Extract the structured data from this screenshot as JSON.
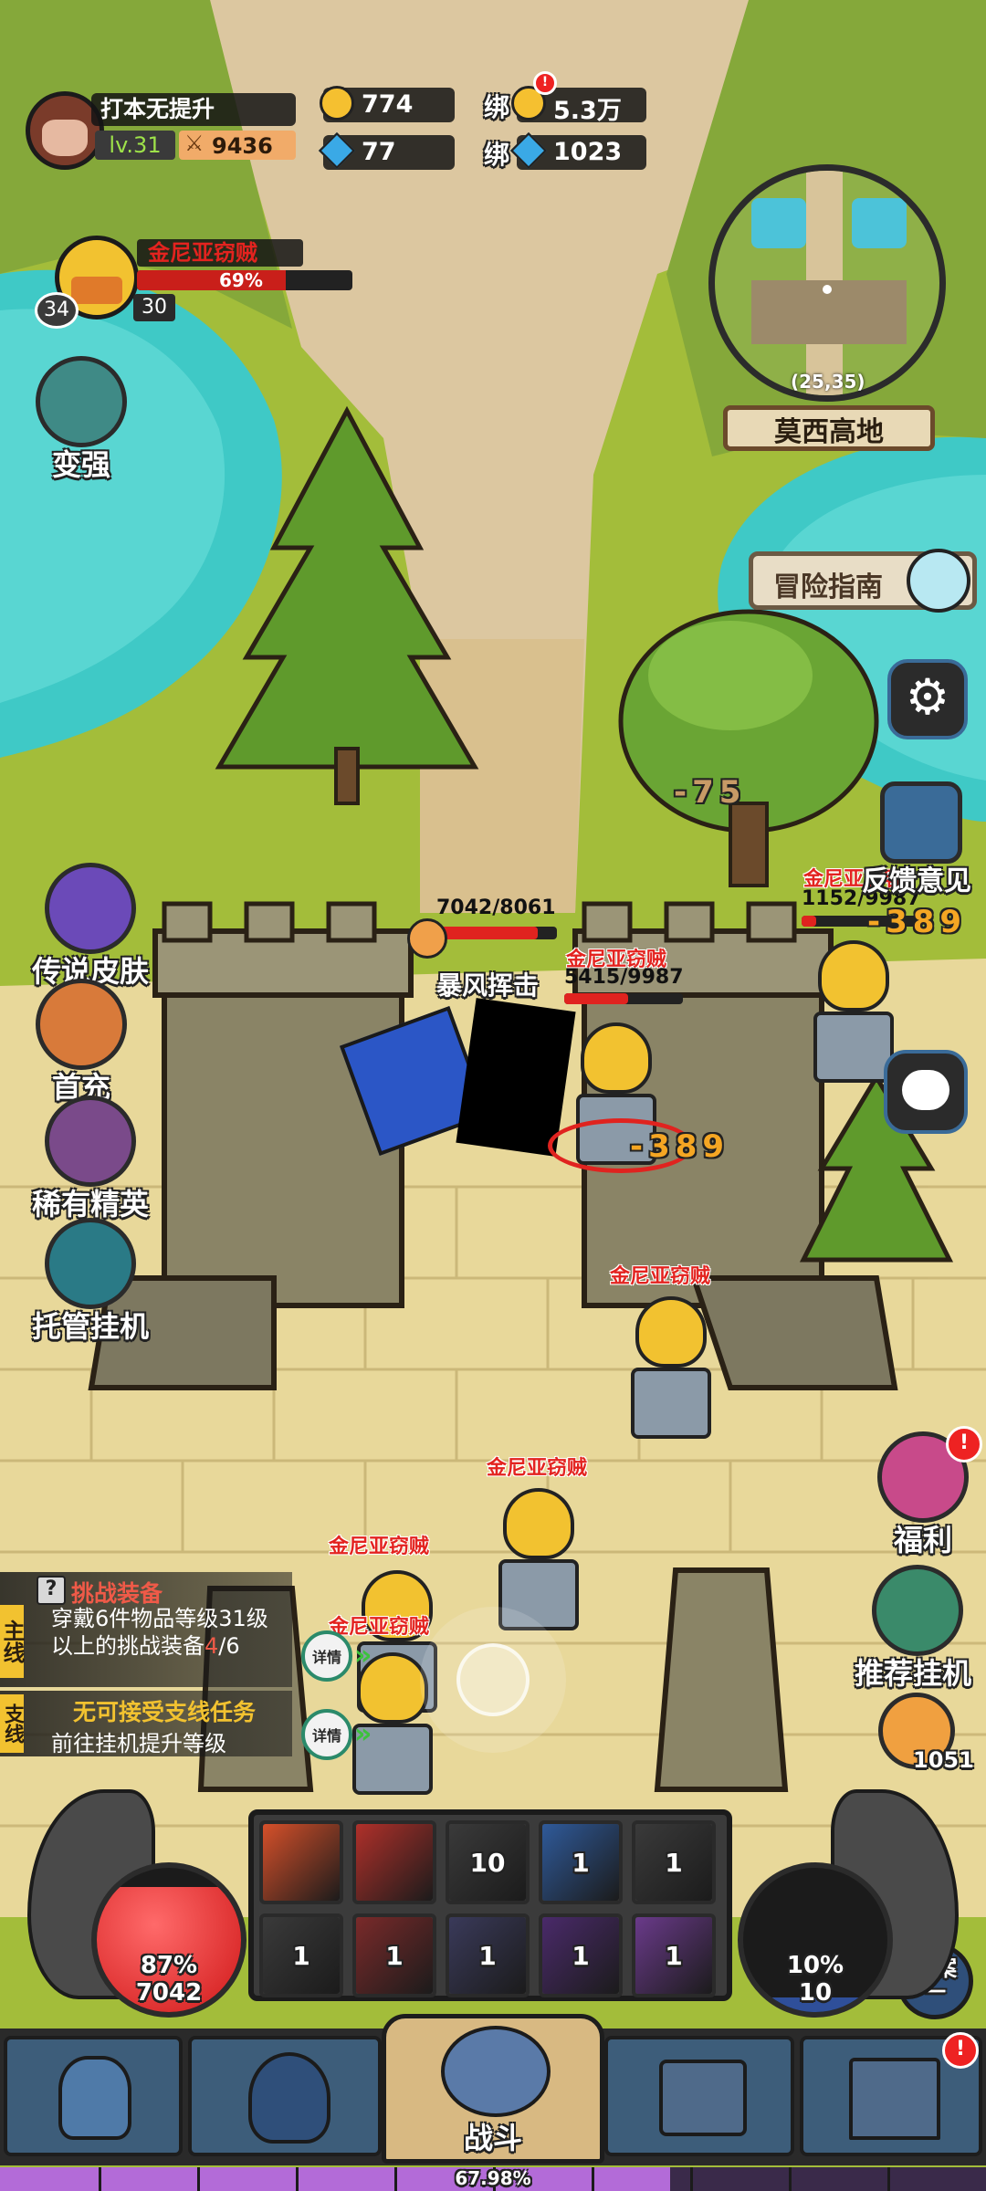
{
  "player": {
    "name": "打本无提升",
    "level": "lv.31",
    "power": "9436"
  },
  "currency": {
    "gold": "774",
    "diamond": "77",
    "bound_label_1": "绑",
    "bound_gold": "5.3万",
    "bound_label_2": "绑",
    "bound_diamond": "1023"
  },
  "target": {
    "name": "金尼亚窃贼",
    "hp_percent": 69,
    "hp_text": "69%",
    "level": "34",
    "count": "30"
  },
  "minimap": {
    "coords": "(25,35)",
    "location": "莫西高地"
  },
  "left_menu": [
    {
      "label": "变强",
      "icon": "upgrade-icon"
    },
    {
      "label": "传说皮肤",
      "icon": "legend-skin-icon"
    },
    {
      "label": "首充",
      "icon": "first-charge-icon"
    },
    {
      "label": "稀有精英",
      "icon": "rare-elite-icon"
    },
    {
      "label": "托管挂机",
      "icon": "auto-idle-icon"
    }
  ],
  "right_menu": {
    "guide": "冒险指南",
    "feedback": "反馈意见",
    "welfare": "福利",
    "recommend": "推荐挂机",
    "pizza_count": "1051",
    "plan": "方案\n一"
  },
  "battle": {
    "player_hp": "7042/8061",
    "skill_name": "暴风挥击",
    "enemy_names": [
      "金尼亚窃贼",
      "金尼亚刺客",
      "金尼亚窃贼",
      "金尼亚窃贼",
      "金尼亚窃贼",
      "金尼亚窃贼"
    ],
    "enemy_hp_main": "5415/9987",
    "enemy_hp_right": "1152/9987",
    "damage_1": "-75",
    "damage_2": "-389",
    "damage_3": "-389"
  },
  "quests": {
    "main_tag": "主线",
    "main_title": "挑战装备",
    "main_desc": "穿戴6件物品等级31级以上的挑战装备",
    "main_progress_cur": "4",
    "main_progress_total": "/6",
    "side_tag": "支线",
    "side_title": "无可接受支线任务",
    "side_desc": "前往挂机提升等级",
    "details": "详情"
  },
  "skills": {
    "slots": [
      "",
      "",
      "10",
      "1",
      "1",
      "1",
      "1",
      "1",
      "1",
      "1"
    ]
  },
  "orbs": {
    "hp_percent": "87%",
    "hp_value": "7042",
    "mp_percent": "10%",
    "mp_value": "10"
  },
  "nav": {
    "battle": "战斗"
  },
  "exp": {
    "percent": 67.98,
    "text": "67.98%"
  },
  "colors": {
    "water": "#3fc9c6",
    "grass": "#a3bd3a",
    "path": "#dcc7a0",
    "hp_red": "#e0231f",
    "exp_purple": "#b36bd8"
  }
}
